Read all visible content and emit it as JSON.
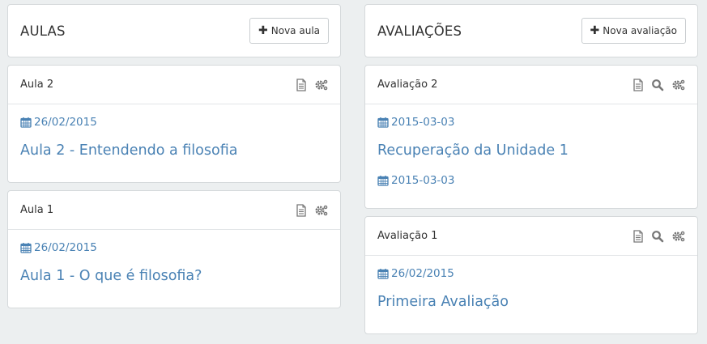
{
  "aulas": {
    "title": "AULAS",
    "add_button": "Nova aula",
    "cards": [
      {
        "name": "Aula 2",
        "date": "26/02/2015",
        "link": "Aula 2 - Entendendo a filosofia"
      },
      {
        "name": "Aula 1",
        "date": "26/02/2015",
        "link": "Aula 1 - O que é filosofia?"
      }
    ]
  },
  "avaliacoes": {
    "title": "AVALIAÇÕES",
    "add_button": "Nova avaliação",
    "cards": [
      {
        "name": "Avaliação 2",
        "date": "2015-03-03",
        "link": "Recuperação da Unidade 1",
        "date2": "2015-03-03"
      },
      {
        "name": "Avaliação 1",
        "date": "26/02/2015",
        "link": "Primeira Avaliação"
      }
    ]
  },
  "icons": [
    "document-icon",
    "gears-icon",
    "search-icon",
    "calendar-icon",
    "plus-icon"
  ],
  "colors": {
    "link": "#4a82b4",
    "background": "#eceff0",
    "icon": "#777777"
  }
}
